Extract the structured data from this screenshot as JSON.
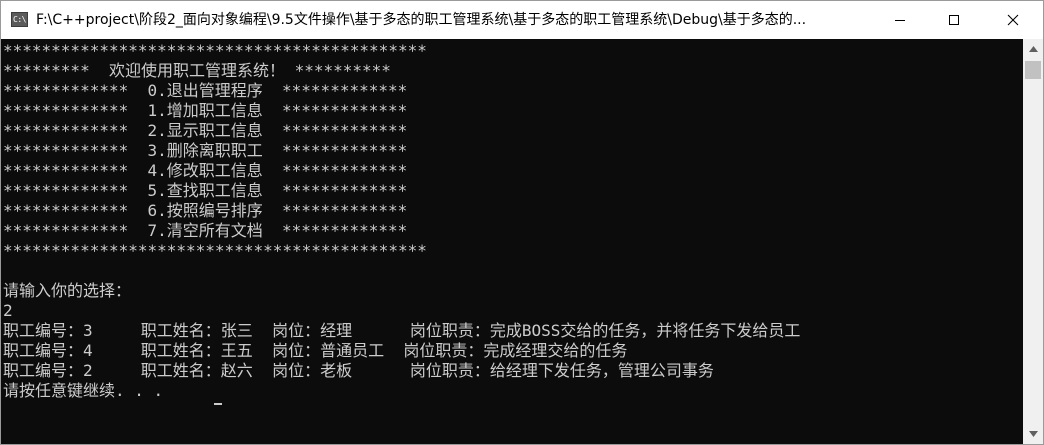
{
  "window": {
    "icon_text": "C:\\",
    "title": "F:\\C++project\\阶段2_面向对象编程\\9.5文件操作\\基于多态的职工管理系统\\基于多态的职工管理系统\\Debug\\基于多态的..."
  },
  "icons": {
    "minimize": "minimize-icon",
    "maximize": "maximize-icon",
    "close": "close-icon",
    "scroll_up": "chevron-up-icon",
    "scroll_down": "chevron-down-icon"
  },
  "console": {
    "lines": [
      "********************************************",
      "*********  欢迎使用职工管理系统！ **********",
      "*************  0.退出管理程序  *************",
      "*************  1.增加职工信息  *************",
      "*************  2.显示职工信息  *************",
      "*************  3.删除离职职工  *************",
      "*************  4.修改职工信息  *************",
      "*************  5.查找职工信息  *************",
      "*************  6.按照编号排序  *************",
      "*************  7.清空所有文档  *************",
      "********************************************",
      "",
      "请输入你的选择：",
      "2",
      "职工编号：3     职工姓名：张三  岗位：经理      岗位职责：完成BOSS交给的任务，并将任务下发给员工",
      "职工编号：4     职工姓名：王五  岗位：普通员工  岗位职责：完成经理交给的任务",
      "职工编号：2     职工姓名：赵六  岗位：老板      岗位职责：给经理下发任务，管理公司事务",
      "请按任意键继续. . ."
    ]
  },
  "colors": {
    "console_bg": "#0c0c0c",
    "console_fg": "#cccccc",
    "titlebar_bg": "#ffffff",
    "scrollbar_bg": "#f0f0f0"
  }
}
